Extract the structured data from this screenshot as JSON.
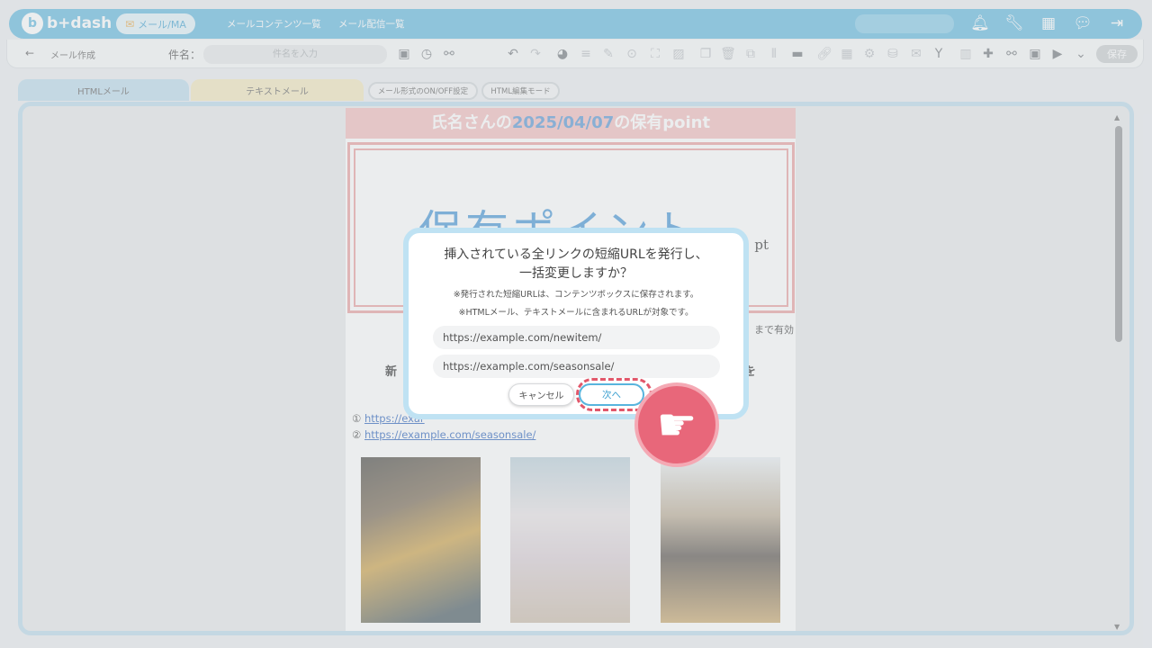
{
  "topbar": {
    "logo_badge": "b",
    "logo_text": "b+dash",
    "active_menu": "メール/MA",
    "nav_links": [
      "メールコンテンツ一覧",
      "メール配信一覧"
    ],
    "icons": [
      "bell-icon",
      "wrench-icon",
      "grid-icon",
      "chat-icon",
      "logout-icon"
    ]
  },
  "toolbar": {
    "back_icon": "←",
    "breadcrumb": "メール作成",
    "subject_label": "件名：",
    "subject_placeholder": "件名を入力",
    "save_label": "保存"
  },
  "tabs": {
    "html": "HTMLメール",
    "text": "テキストメール",
    "format_toggle": "メール形式のON/OFF設定",
    "html_edit_mode": "HTML編集モード"
  },
  "mail": {
    "header_prefix": "氏名さんの",
    "header_date": "2025/04/07",
    "header_suffix": "の保有point",
    "point_title": "保有ポイント",
    "point_unit": "pt",
    "valid_text": "まで有効",
    "heading_left": "新",
    "heading_right": "を",
    "link1_num": "①",
    "link1_text": "https://exar",
    "link2_num": "②",
    "link2_text": "https://example.com/seasonsale/"
  },
  "modal": {
    "title_line1": "挿入されている全リンクの短縮URLを発行し、",
    "title_line2": "一括変更しますか？",
    "note1": "※発行された短縮URLは、コンテンツボックスに保存されます。",
    "note2": "※HTMLメール、テキストメールに含まれるURLが対象です。",
    "urls": [
      "https://example.com/newitem/",
      "https://example.com/seasonsale/"
    ],
    "cancel_label": "キャンセル",
    "next_label": "次へ"
  },
  "colors": {
    "brand": "#58b4dd",
    "header_pink": "#f2b9b9",
    "highlight": "#e2576a"
  }
}
